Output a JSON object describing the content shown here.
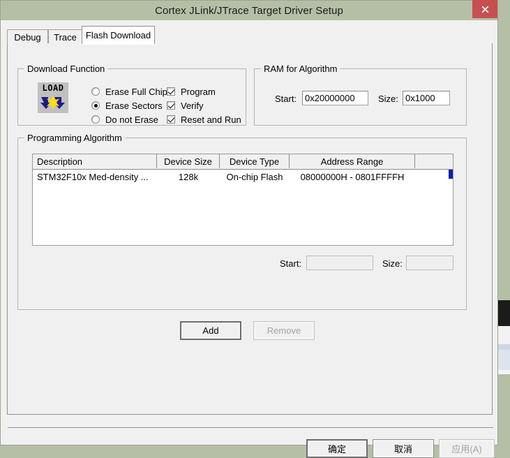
{
  "window": {
    "title": "Cortex JLink/JTrace Target Driver Setup",
    "close_label": "close-icon"
  },
  "tabs": [
    {
      "label": "Debug",
      "active": false
    },
    {
      "label": "Trace",
      "active": false
    },
    {
      "label": "Flash Download",
      "active": true
    }
  ],
  "download_function": {
    "group_title": "Download Function",
    "icon_text": "LOAD",
    "radios": [
      {
        "label": "Erase Full Chip",
        "checked": false
      },
      {
        "label": "Erase Sectors",
        "checked": true
      },
      {
        "label": "Do not Erase",
        "checked": false
      }
    ],
    "checkboxes": [
      {
        "label": "Program",
        "checked": true
      },
      {
        "label": "Verify",
        "checked": true
      },
      {
        "label": "Reset and Run",
        "checked": true
      }
    ]
  },
  "ram_for_algorithm": {
    "group_title": "RAM for Algorithm",
    "start_label": "Start:",
    "start_value": "0x20000000",
    "size_label": "Size:",
    "size_value": "0x1000"
  },
  "programming_algorithm": {
    "group_title": "Programming Algorithm",
    "columns": [
      "Description",
      "Device Size",
      "Device Type",
      "Address Range",
      ""
    ],
    "rows": [
      {
        "description": "STM32F10x Med-density ...",
        "device_size": "128k",
        "device_type": "On-chip Flash",
        "address_range": "08000000H - 0801FFFFH",
        "extra": ""
      }
    ],
    "start_label": "Start:",
    "start_value": "",
    "size_label": "Size:",
    "size_value": "",
    "add_label": "Add",
    "remove_label": "Remove"
  },
  "footer": {
    "ok_label": "确定",
    "cancel_label": "取消",
    "apply_label": "应用(A)"
  },
  "colors": {
    "titlebar": "#b5bfa6",
    "close_button": "#c64f4f",
    "dialog_face": "#f0f0f0",
    "field_white": "#ffffff",
    "row_marker": "#0a1eb4",
    "icon_arrow": "#1a1a8c",
    "icon_star": "#ffe000"
  }
}
